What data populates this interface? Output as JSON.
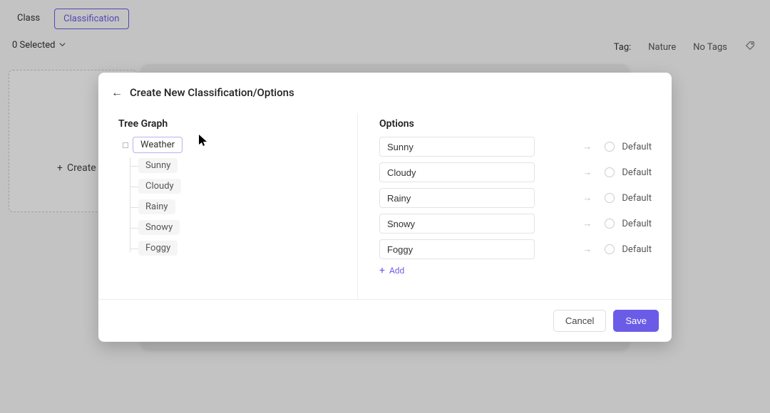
{
  "background": {
    "tabs": [
      "Class",
      "Classification"
    ],
    "selected_text": "0 Selected",
    "tag_label": "Tag:",
    "tag_value": "Nature",
    "no_tags": "No Tags",
    "create_text": "Create"
  },
  "modal": {
    "title": "Create New Classification/Options",
    "tree_title": "Tree Graph",
    "tree_root": "Weather",
    "tree_children": [
      "Sunny",
      "Cloudy",
      "Rainy",
      "Snowy",
      "Foggy"
    ],
    "options_title": "Options",
    "options": [
      {
        "value": "Sunny",
        "default_label": "Default"
      },
      {
        "value": "Cloudy",
        "default_label": "Default"
      },
      {
        "value": "Rainy",
        "default_label": "Default"
      },
      {
        "value": "Snowy",
        "default_label": "Default"
      },
      {
        "value": "Foggy",
        "default_label": "Default"
      }
    ],
    "add_label": "Add",
    "cancel_label": "Cancel",
    "save_label": "Save"
  },
  "colors": {
    "accent": "#6b5ce7"
  }
}
